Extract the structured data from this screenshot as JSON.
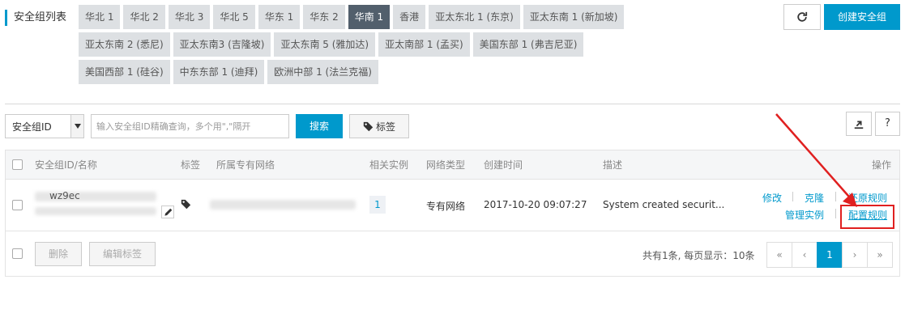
{
  "header": {
    "title": "安全组列表",
    "refresh_icon": "refresh-icon",
    "create_button": "创建安全组"
  },
  "regions": [
    {
      "label": "华北 1",
      "active": false
    },
    {
      "label": "华北 2",
      "active": false
    },
    {
      "label": "华北 3",
      "active": false
    },
    {
      "label": "华北 5",
      "active": false
    },
    {
      "label": "华东 1",
      "active": false
    },
    {
      "label": "华东 2",
      "active": false
    },
    {
      "label": "华南 1",
      "active": true
    },
    {
      "label": "香港",
      "active": false
    },
    {
      "label": "亚太东北 1 (东京)",
      "active": false
    },
    {
      "label": "亚太东南 1 (新加坡)",
      "active": false
    },
    {
      "label": "亚太东南 2 (悉尼)",
      "active": false
    },
    {
      "label": "亚太东南3 (吉隆坡)",
      "active": false
    },
    {
      "label": "亚太东南 5 (雅加达)",
      "active": false
    },
    {
      "label": "亚太南部 1 (孟买)",
      "active": false
    },
    {
      "label": "美国东部 1 (弗吉尼亚)",
      "active": false
    },
    {
      "label": "美国西部 1 (硅谷)",
      "active": false
    },
    {
      "label": "中东东部 1 (迪拜)",
      "active": false
    },
    {
      "label": "欧洲中部 1 (法兰克福)",
      "active": false
    }
  ],
  "toolbar": {
    "filter_select": "安全组ID",
    "search_placeholder": "输入安全组ID精确查询，多个用\",\"隔开",
    "search_button": "搜索",
    "tag_button": "标签",
    "export_icon": "export-icon",
    "help_label": "?"
  },
  "table": {
    "columns": {
      "id_name": "安全组ID/名称",
      "tags": "标签",
      "vpc": "所属专有网络",
      "instances": "相关实例",
      "network_type": "网络类型",
      "created": "创建时间",
      "description": "描述",
      "actions": "操作"
    },
    "rows": [
      {
        "id_partial": "wz9ec",
        "instances": "1",
        "network_type": "专有网络",
        "created": "2017-10-20 09:07:27",
        "description": "System created securit...",
        "actions": {
          "modify": "修改",
          "clone": "克隆",
          "restore": "还原规则",
          "manage": "管理实例",
          "configure": "配置规则"
        }
      }
    ]
  },
  "footer": {
    "delete_button": "删除",
    "edit_tags_button": "编辑标签",
    "summary": "共有1条, 每页显示：10条",
    "pager": {
      "first": "«",
      "prev": "‹",
      "current": "1",
      "next": "›",
      "last": "»"
    }
  },
  "colors": {
    "accent": "#0099cc",
    "active_tab": "#525f6c",
    "highlight": "#e02020"
  }
}
